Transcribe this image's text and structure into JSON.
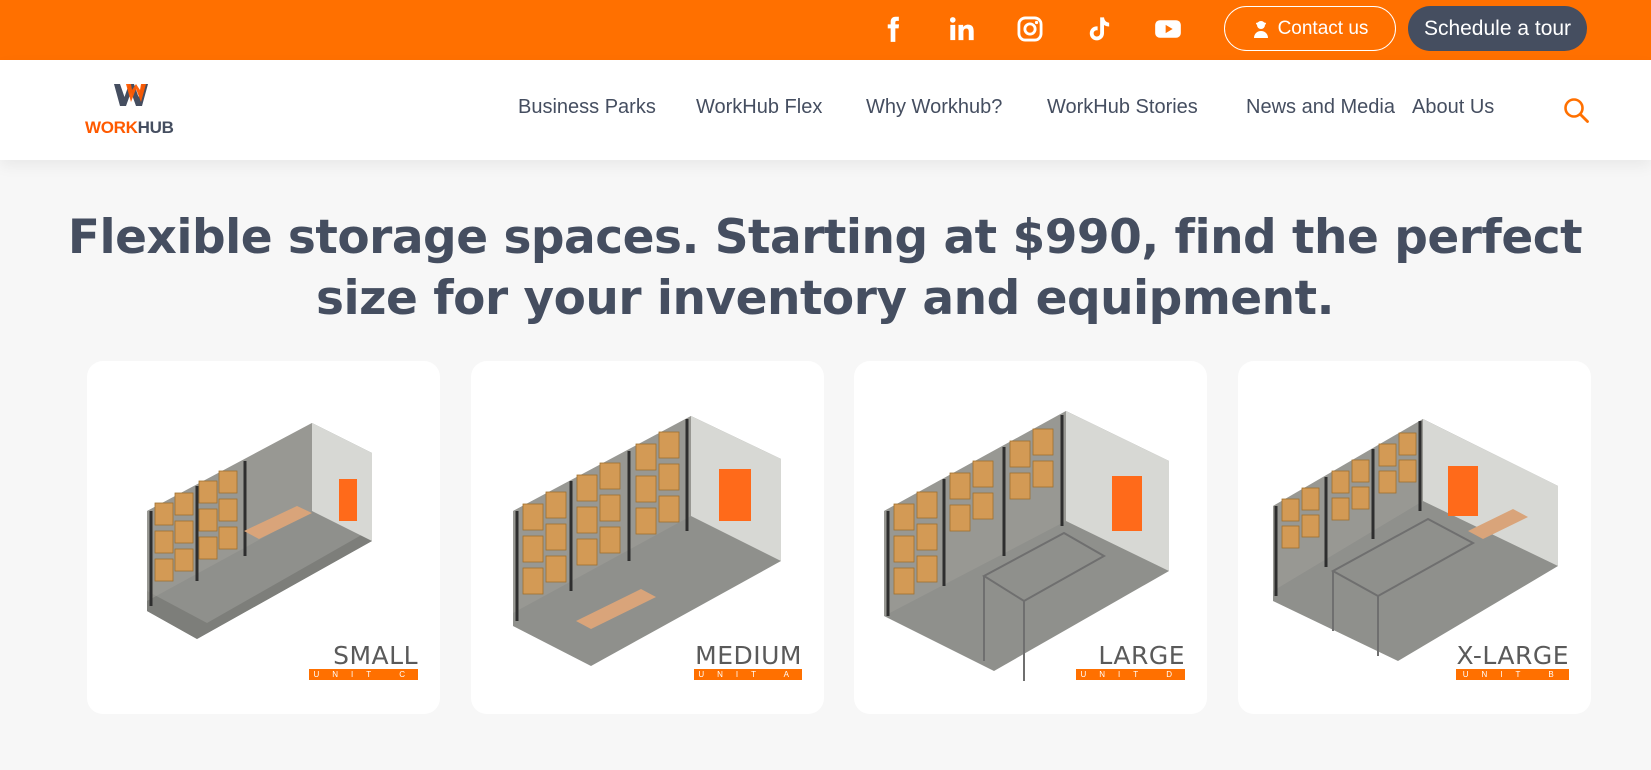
{
  "topbar": {
    "social": [
      "facebook-icon",
      "linkedin-icon",
      "instagram-icon",
      "tiktok-icon",
      "youtube-icon"
    ],
    "contact_label": "Contact us",
    "tour_label": "Schedule a tour"
  },
  "brand": {
    "name_part1": "WORK",
    "name_part2": "HUB",
    "accent": "#ff7000",
    "dark": "#454e60"
  },
  "nav": {
    "items": [
      "Business Parks",
      "WorkHub Flex",
      "Why Workhub?",
      "WorkHub Stories",
      "News and Media",
      "About Us"
    ]
  },
  "hero": {
    "headline_line1": "Flexible storage spaces. Starting at $990, find the perfect",
    "headline_line2": "size for your inventory and equipment."
  },
  "units": [
    {
      "size": "SMALL",
      "unit": "UNIT C"
    },
    {
      "size": "MEDIUM",
      "unit": "UNIT A"
    },
    {
      "size": "LARGE",
      "unit": "UNIT D"
    },
    {
      "size": "X-LARGE",
      "unit": "UNIT B"
    }
  ]
}
